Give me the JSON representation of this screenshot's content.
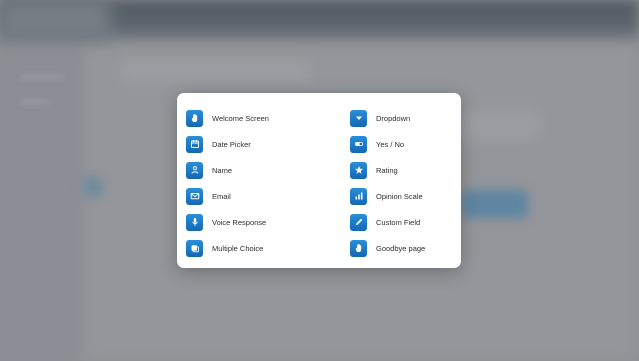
{
  "modal": {
    "left_column": [
      {
        "label": "Welcome Screen",
        "icon": "hand-wave-icon"
      },
      {
        "label": "Date Picker",
        "icon": "calendar-icon"
      },
      {
        "label": "Name",
        "icon": "person-icon"
      },
      {
        "label": "Email",
        "icon": "envelope-icon"
      },
      {
        "label": "Voice Response",
        "icon": "microphone-icon"
      },
      {
        "label": "Multiple Choice",
        "icon": "multiple-choice-icon"
      }
    ],
    "right_column": [
      {
        "label": "Dropdown",
        "icon": "chevron-down-icon"
      },
      {
        "label": "Yes / No",
        "icon": "toggle-icon"
      },
      {
        "label": "Rating",
        "icon": "star-icon"
      },
      {
        "label": "Opinion Scale",
        "icon": "bar-scale-icon"
      },
      {
        "label": "Custom Field",
        "icon": "pencil-icon"
      },
      {
        "label": "Goodbye page",
        "icon": "hand-wave-icon"
      }
    ]
  },
  "colors": {
    "icon_gradient_top": "#2b8fd8",
    "icon_gradient_bottom": "#1467b3",
    "label_text": "#2d2f33",
    "modal_bg": "#ffffff"
  }
}
